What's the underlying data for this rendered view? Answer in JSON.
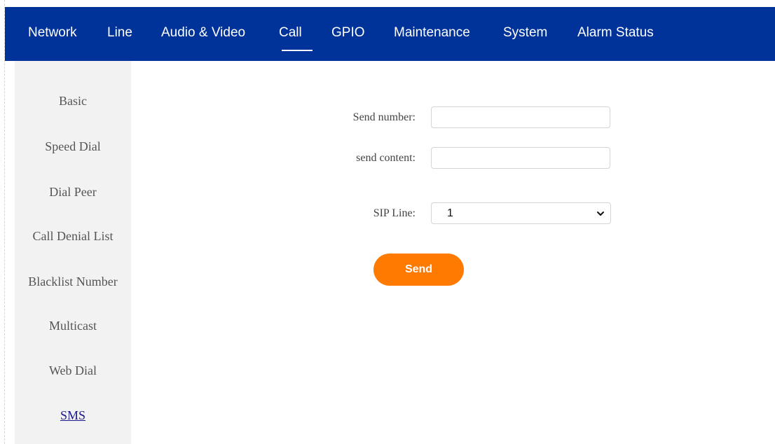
{
  "nav": {
    "items": [
      {
        "label": "Network"
      },
      {
        "label": "Line"
      },
      {
        "label": "Audio & Video"
      },
      {
        "label": "Call",
        "active": true
      },
      {
        "label": "GPIO"
      },
      {
        "label": "Maintenance"
      },
      {
        "label": "System"
      },
      {
        "label": "Alarm Status"
      }
    ]
  },
  "sidebar": {
    "items": [
      {
        "label": "Basic"
      },
      {
        "label": "Speed Dial"
      },
      {
        "label": "Dial Peer"
      },
      {
        "label": "Call Denial List"
      },
      {
        "label": "Blacklist Number"
      },
      {
        "label": "Multicast"
      },
      {
        "label": "Web Dial"
      },
      {
        "label": "SMS",
        "active": true
      }
    ]
  },
  "form": {
    "send_number": {
      "label": "Send number:",
      "value": ""
    },
    "send_content": {
      "label": "send content:",
      "value": ""
    },
    "sip_line": {
      "label": "SIP Line:",
      "value": "1"
    },
    "send_button_label": "Send"
  },
  "colors": {
    "nav_background": "#003399",
    "sidebar_background": "#f2f2f2",
    "send_button": "#ff7a00",
    "active_link": "#1a1a8c"
  },
  "icons": {
    "dropdown": "chevron-down-icon"
  }
}
